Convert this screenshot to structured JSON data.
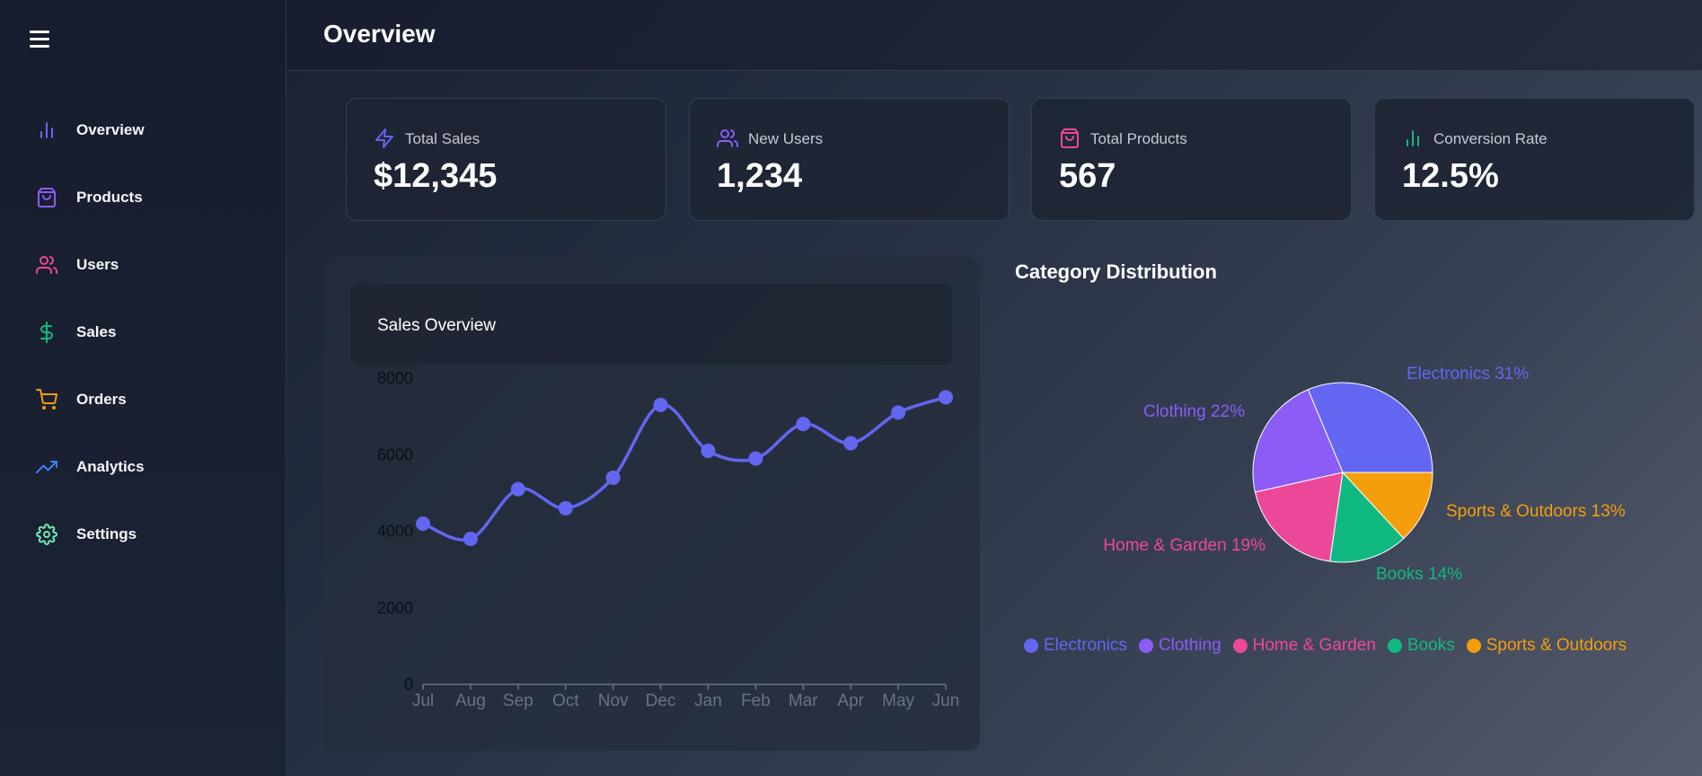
{
  "header": {
    "title": "Overview"
  },
  "sidebar": {
    "items": [
      {
        "label": "Overview",
        "icon": "bar-chart-icon",
        "color": "#6366f1"
      },
      {
        "label": "Products",
        "icon": "shopping-bag-icon",
        "color": "#8b5cf6"
      },
      {
        "label": "Users",
        "icon": "users-icon",
        "color": "#ec4899"
      },
      {
        "label": "Sales",
        "icon": "dollar-icon",
        "color": "#10b981"
      },
      {
        "label": "Orders",
        "icon": "shopping-cart-icon",
        "color": "#f59e0b"
      },
      {
        "label": "Analytics",
        "icon": "trending-up-icon",
        "color": "#3b82f6"
      },
      {
        "label": "Settings",
        "icon": "gear-icon",
        "color": "#6ee7b7"
      }
    ]
  },
  "stats": [
    {
      "label": "Total Sales",
      "value": "$12,345",
      "icon": "zap-icon",
      "color": "#6366f1"
    },
    {
      "label": "New Users",
      "value": "1,234",
      "icon": "users-icon",
      "color": "#8b5cf6"
    },
    {
      "label": "Total Products",
      "value": "567",
      "icon": "shopping-bag-icon",
      "color": "#ec4899"
    },
    {
      "label": "Conversion Rate",
      "value": "12.5%",
      "icon": "bar-chart-icon",
      "color": "#10b981"
    }
  ],
  "chart_data": [
    {
      "type": "line",
      "title": "Sales Overview",
      "categories": [
        "Jul",
        "Aug",
        "Sep",
        "Oct",
        "Nov",
        "Dec",
        "Jan",
        "Feb",
        "Mar",
        "Apr",
        "May",
        "Jun"
      ],
      "series": [
        {
          "values": [
            4200,
            3800,
            5100,
            4600,
            5400,
            7300,
            6100,
            5900,
            6800,
            6300,
            7100,
            7500
          ],
          "color": "#6366f1"
        }
      ],
      "yticks": [
        0,
        2000,
        4000,
        6000,
        8000
      ],
      "ylim": [
        0,
        8000
      ],
      "grid": false
    },
    {
      "type": "pie",
      "title": "Category Distribution",
      "slices": [
        {
          "name": "Electronics",
          "value": 31,
          "label": "Electronics 31%",
          "color": "#6366f1"
        },
        {
          "name": "Clothing",
          "value": 22,
          "label": "Clothing 22%",
          "color": "#8b5cf6"
        },
        {
          "name": "Home & Garden",
          "value": 19,
          "label": "Home & Garden 19%",
          "color": "#ec4899"
        },
        {
          "name": "Books",
          "value": 14,
          "label": "Books 14%",
          "color": "#10b981"
        },
        {
          "name": "Sports & Outdoors",
          "value": 13,
          "label": "Sports & Outdoors 13%",
          "color": "#f59e0b"
        }
      ],
      "legend_position": "bottom"
    }
  ]
}
